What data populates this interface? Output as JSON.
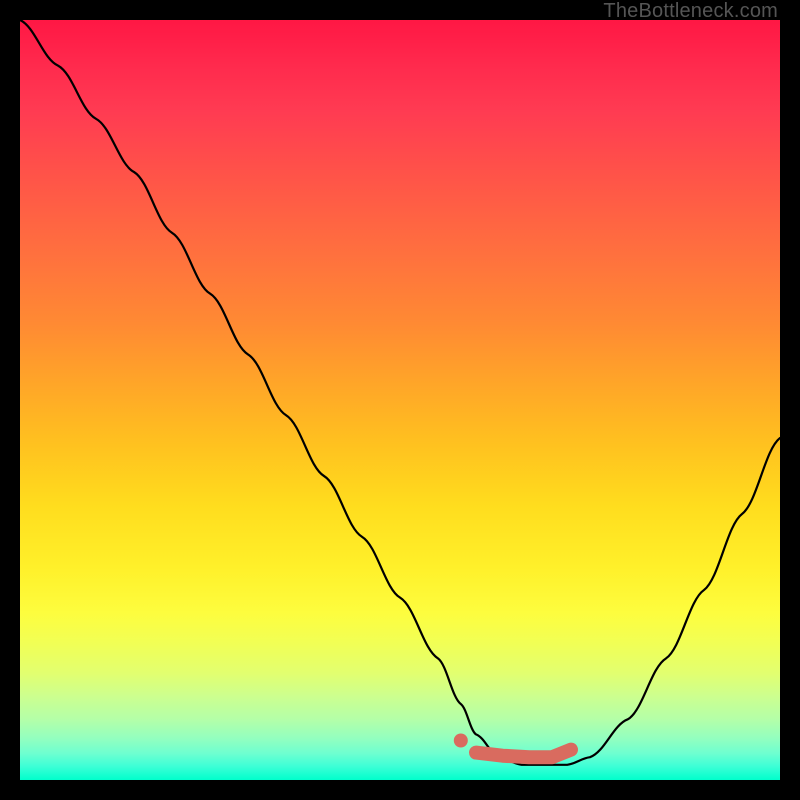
{
  "watermark": "TheBottleneck.com",
  "colors": {
    "background": "#000000",
    "curve": "#000000",
    "marker_fill": "#d96b5f",
    "marker_stroke": "#d96b5f"
  },
  "chart_data": {
    "type": "line",
    "title": "",
    "xlabel": "",
    "ylabel": "",
    "xlim": [
      0,
      100
    ],
    "ylim": [
      0,
      100
    ],
    "grid": false,
    "legend": false,
    "series": [
      {
        "name": "bottleneck-curve",
        "x": [
          0,
          5,
          10,
          15,
          20,
          25,
          30,
          35,
          40,
          45,
          50,
          55,
          58,
          60,
          63,
          66,
          70,
          72,
          75,
          80,
          85,
          90,
          95,
          100
        ],
        "y": [
          100,
          94,
          87,
          80,
          72,
          64,
          56,
          48,
          40,
          32,
          24,
          16,
          10,
          6,
          3,
          2,
          2,
          2,
          3,
          8,
          16,
          25,
          35,
          45
        ]
      }
    ],
    "markers": [
      {
        "name": "dot",
        "x": 58,
        "y": 5.2
      },
      {
        "name": "band-start",
        "x": 60,
        "y": 3.6
      },
      {
        "name": "band-mid1",
        "x": 63.5,
        "y": 3.2
      },
      {
        "name": "band-mid2",
        "x": 67,
        "y": 3.0
      },
      {
        "name": "band-mid3",
        "x": 70,
        "y": 3.0
      },
      {
        "name": "band-end-bump",
        "x": 72.5,
        "y": 4.0
      }
    ]
  }
}
